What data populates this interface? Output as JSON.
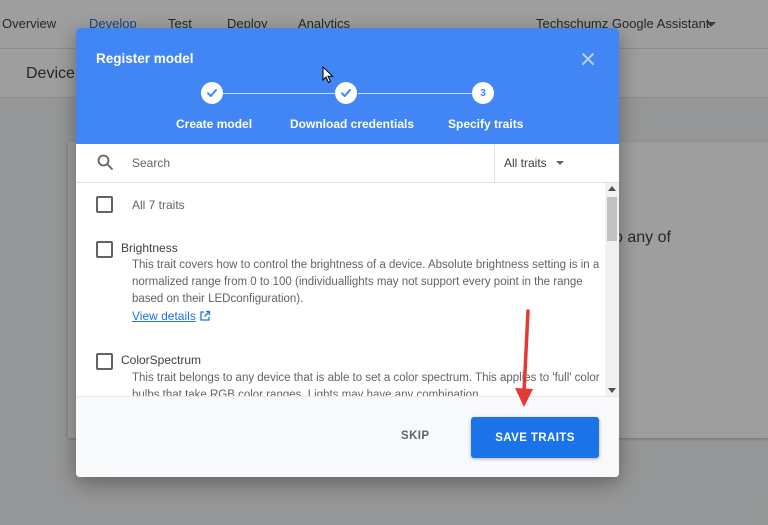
{
  "topnav": {
    "items": [
      {
        "label": "Overview",
        "active": false
      },
      {
        "label": "Develop",
        "active": true
      },
      {
        "label": "Test",
        "active": false
      },
      {
        "label": "Deploy",
        "active": false
      },
      {
        "label": "Analytics",
        "active": false
      }
    ],
    "project_name": "Techschumz Google Assistant"
  },
  "background": {
    "section_title": "Device",
    "card_fragment": "o any of"
  },
  "dialog": {
    "title": "Register model",
    "steps": [
      {
        "label": "Create model",
        "state": "done"
      },
      {
        "label": "Download credentials",
        "state": "done"
      },
      {
        "label": "Specify traits",
        "state": "current",
        "number": "3"
      }
    ],
    "search": {
      "placeholder": "Search",
      "value": ""
    },
    "filter": {
      "selected": "All traits"
    },
    "all_traits_label": "All 7 traits",
    "traits": [
      {
        "name": "Brightness",
        "description": "This trait covers how to control the brightness of a device. Absolute brightness setting is in a normalized range from 0 to 100 (individuallights may not support every point in the range based on their LEDconfiguration).",
        "link": "View details"
      },
      {
        "name": "ColorSpectrum",
        "description": "This trait belongs to any device that is able to set a color spectrum. This applies to 'full' color bulbs that take RGB color ranges. Lights may have any combination"
      }
    ],
    "footer": {
      "skip_label": "SKIP",
      "save_label": "SAVE TRAITS"
    }
  },
  "colors": {
    "header_blue": "#4285f4",
    "primary_button": "#1a73e8",
    "annotation_arrow": "#e53935"
  },
  "icons": {
    "close": "close-icon",
    "search": "search-icon",
    "check": "check-icon",
    "external_link": "external-link-icon",
    "caret": "chevron-down-icon"
  }
}
